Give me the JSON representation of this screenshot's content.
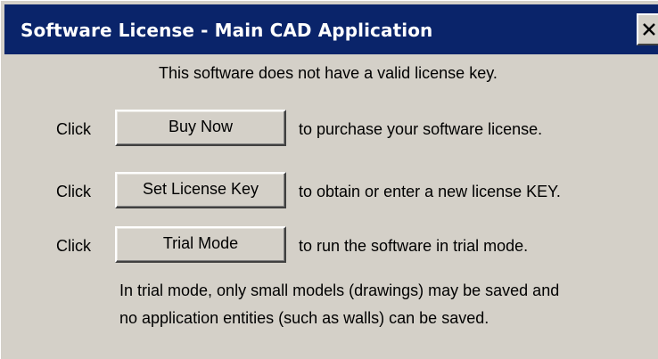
{
  "window": {
    "title": "Software License - Main CAD Application",
    "close_glyph": "X"
  },
  "message": "This software does not have a valid license key.",
  "rows": [
    {
      "prefix": "Click",
      "button_label": "Buy Now",
      "description": "to purchase your software license."
    },
    {
      "prefix": "Click",
      "button_label": "Set License Key",
      "description": "to obtain or enter a new license KEY."
    },
    {
      "prefix": "Click",
      "button_label": "Trial Mode",
      "description": "to run the software in trial mode."
    }
  ],
  "trial_note": {
    "line1": "In trial mode, only small models (drawings) may be saved and",
    "line2": "no application entities (such as walls) can be saved."
  },
  "colors": {
    "titlebar": "#0a246a",
    "dialog_face": "#d4d0c8",
    "title_text": "#ffffff"
  }
}
